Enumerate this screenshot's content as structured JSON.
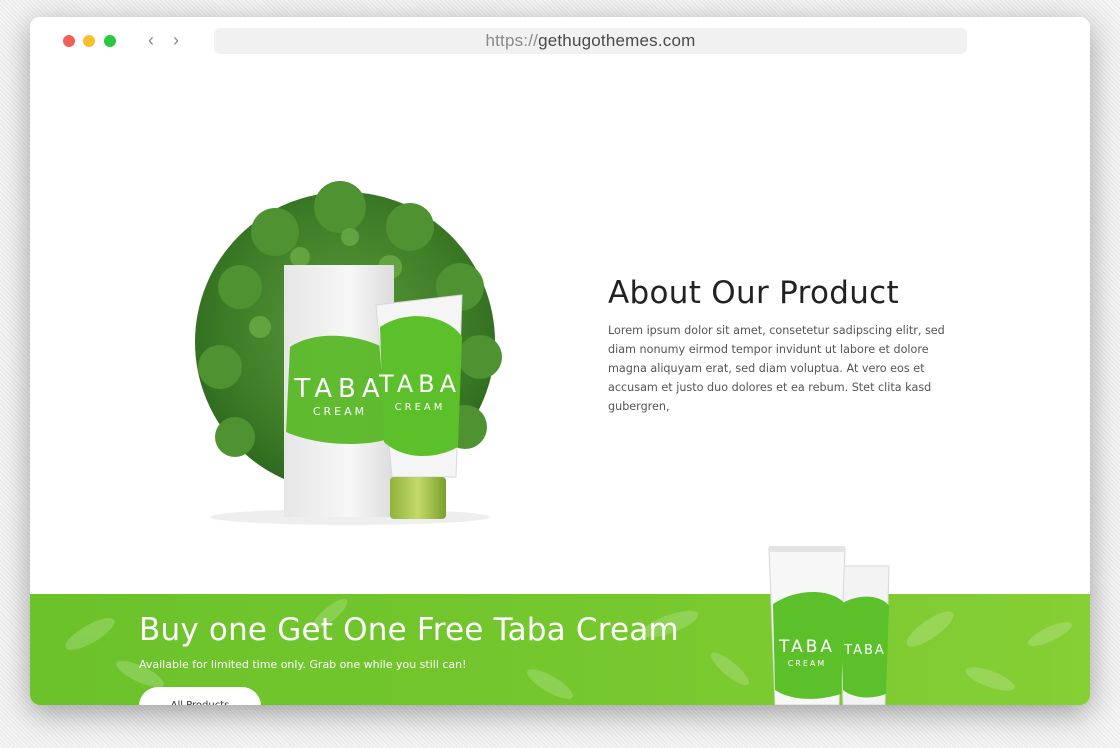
{
  "browser": {
    "url_scheme": "https://",
    "url_host": "gethugothemes.com",
    "back_icon": "chevron-left-icon",
    "forward_icon": "chevron-right-icon"
  },
  "product_image": {
    "box_text": "TABA",
    "box_sub": "CREAM",
    "tube_text": "TABA",
    "tube_sub": "CREAM"
  },
  "about": {
    "title": "About Our Product",
    "body": "Lorem ipsum dolor sit amet, consetetur sadipscing elitr, sed diam nonumy eirmod tempor invidunt ut labore et dolore magna aliquyam erat, sed diam voluptua. At vero eos et accusam et justo duo dolores et ea rebum. Stet clita kasd gubergren,"
  },
  "promo": {
    "title": "Buy one Get One Free Taba Cream",
    "subtitle": "Available for limited time only. Grab one while you still can!",
    "button_label": "All Products",
    "tube_text": "TABA",
    "tube_sub": "CREAM"
  },
  "colors": {
    "banner_green": "#74c72d",
    "leaf_green": "#3f8a2a",
    "paint_green": "#5cc02a"
  }
}
